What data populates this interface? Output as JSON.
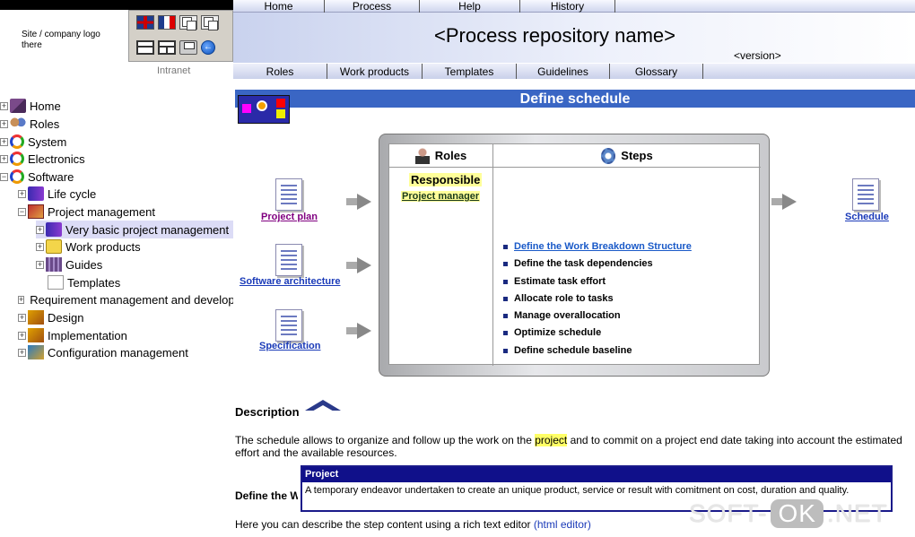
{
  "left": {
    "logo_text": "Site / company logo there",
    "intranet": "Intranet",
    "toolbar_icons": [
      "flag-uk-icon",
      "flag-fr-icon",
      "copy-icon",
      "copy-icon",
      "frame-icon",
      "frameset-icon",
      "print-icon",
      "back-icon"
    ],
    "tree": [
      {
        "label": "Home",
        "icon": "home-icon"
      },
      {
        "label": "Roles",
        "icon": "roles-icon"
      },
      {
        "label": "System",
        "icon": "ring-icon"
      },
      {
        "label": "Electronics",
        "icon": "ring-icon"
      },
      {
        "label": "Software",
        "icon": "ring-icon"
      },
      {
        "label": "Life cycle",
        "icon": "lifecycle-icon"
      },
      {
        "label": "Project management",
        "icon": "discipline-icon"
      },
      {
        "label": "Very basic project management",
        "icon": "process-icon"
      },
      {
        "label": "Work products",
        "icon": "folder-icon"
      },
      {
        "label": "Guides",
        "icon": "guides-icon"
      },
      {
        "label": "Templates",
        "icon": "page-icon"
      },
      {
        "label": "Requirement management and development",
        "icon": "discipline-icon"
      },
      {
        "label": "Design",
        "icon": "tool-icon"
      },
      {
        "label": "Implementation",
        "icon": "tool-icon"
      },
      {
        "label": "Configuration management",
        "icon": "config-icon"
      }
    ]
  },
  "nav": {
    "tabs": [
      "Home",
      "Process",
      "Help",
      "History"
    ],
    "subtabs": [
      "Roles",
      "Work products",
      "Templates",
      "Guidelines",
      "Glossary"
    ]
  },
  "header": {
    "repo_name": "<Process repository name>",
    "version": "<version>"
  },
  "main": {
    "title": "Define schedule",
    "inputs": [
      "Project plan",
      "Software architecture",
      "Specification"
    ],
    "output": "Schedule",
    "roles_header": "Roles",
    "steps_header": "Steps",
    "responsible_label": "Responsible",
    "responsible_role": "Project manager",
    "steps": [
      "Define the Work Breakdown Structure",
      "Define the task dependencies",
      "Estimate task effort",
      "Allocate role to tasks",
      "Manage overallocation",
      "Optimize schedule",
      "Define schedule baseline"
    ],
    "description_title": "Description",
    "description_before": "The schedule allows to organize and follow up the work on the ",
    "description_highlight": "project",
    "description_after": " and to commit on a project end date taking into account the estimated effort and the available resources.",
    "define_title": "Define the Work Breakdown Structure",
    "here_text": "Here you can describe the step content using a rich text editor ",
    "html_editor": "(html editor)"
  },
  "tooltip": {
    "title": "Project",
    "text": "A temporary endeavor undertaken to create an unique product, service or result with comitment on cost, duration and quality."
  },
  "watermark": {
    "left": "SOFT-",
    "ok": "OK",
    "right": ".NET"
  }
}
